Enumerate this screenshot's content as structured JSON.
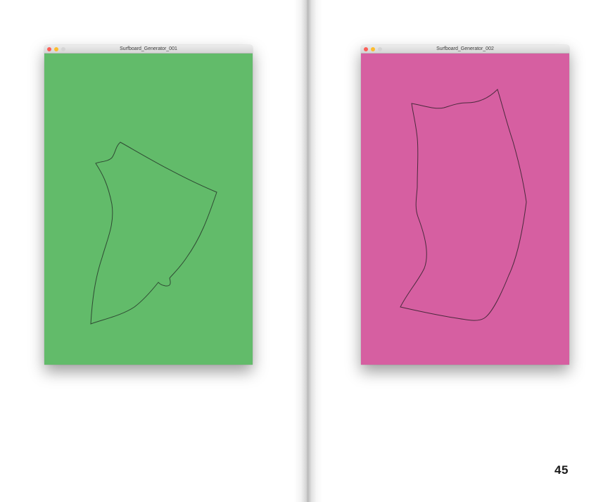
{
  "windows": [
    {
      "title": "Surfboard_Generator_001",
      "canvas_color": "#62bb6a",
      "outline_color": "#2f4a33"
    },
    {
      "title": "Surfboard_Generator_002",
      "canvas_color": "#d65fa1",
      "outline_color": "#4a2a3c"
    }
  ],
  "page": {
    "number": "45"
  }
}
